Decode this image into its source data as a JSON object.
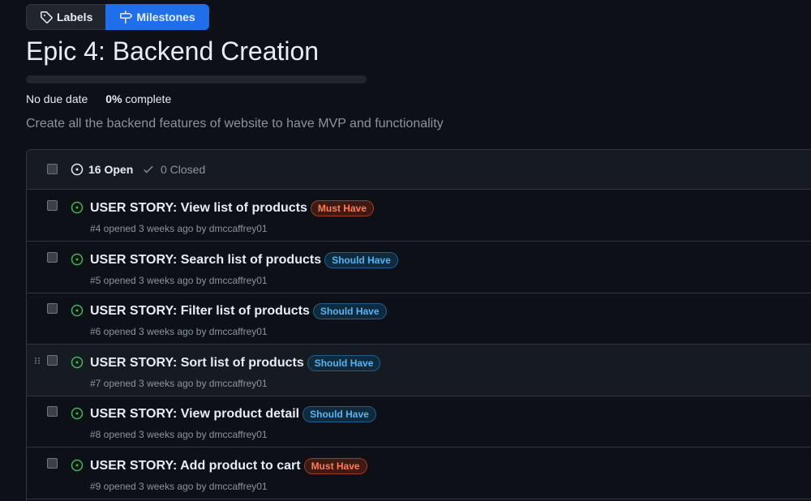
{
  "tabs": {
    "labels": "Labels",
    "milestones": "Milestones"
  },
  "milestone": {
    "title": "Epic 4: Backend Creation",
    "progress_percent": 0,
    "due_date": "No due date",
    "percent_text": "0%",
    "complete_text": "complete",
    "description": "Create all the backend features of website to have MVP and functionality"
  },
  "issues_header": {
    "open": "16 Open",
    "closed": "0 Closed"
  },
  "colors": {
    "accent_blue": "#1f6feb",
    "open_green": "#3fb950",
    "must_have": "#ff7b5c",
    "should_have": "#58b3f0"
  },
  "issues": [
    {
      "title": "USER STORY: View list of products",
      "label": "Must Have",
      "sub": "#4 opened 3 weeks ago by dmccaffrey01"
    },
    {
      "title": "USER STORY: Search list of products",
      "label": "Should Have",
      "sub": "#5 opened 3 weeks ago by dmccaffrey01"
    },
    {
      "title": "USER STORY: Filter list of products",
      "label": "Should Have",
      "sub": "#6 opened 3 weeks ago by dmccaffrey01"
    },
    {
      "title": "USER STORY: Sort list of products",
      "label": "Should Have",
      "sub": "#7 opened 3 weeks ago by dmccaffrey01"
    },
    {
      "title": "USER STORY: View product detail",
      "label": "Should Have",
      "sub": "#8 opened 3 weeks ago by dmccaffrey01"
    },
    {
      "title": "USER STORY: Add product to cart",
      "label": "Must Have",
      "sub": "#9 opened 3 weeks ago by dmccaffrey01"
    }
  ]
}
